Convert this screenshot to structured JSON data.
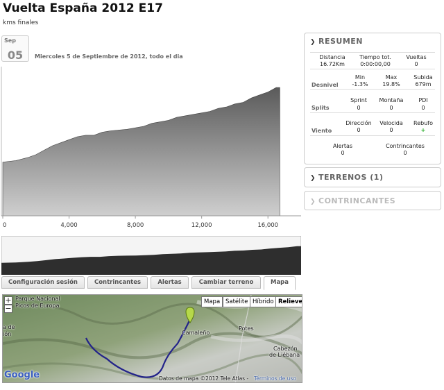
{
  "header": {
    "title": "Vuelta España 2012 E17",
    "subtitle": "kms finales"
  },
  "date": {
    "month": "Sep",
    "day": "05",
    "text": "Miercoles 5 de Septiembre de 2012, todo el dia"
  },
  "chart_data": {
    "type": "area",
    "x_unit": "m",
    "x_ticks": [
      "0",
      "4,000",
      "8,000",
      "12,000",
      "16,000"
    ],
    "xlim": [
      0,
      18000
    ],
    "x": [
      0,
      800,
      1500,
      2000,
      2500,
      3000,
      3500,
      4000,
      4500,
      5000,
      5500,
      6000,
      6500,
      7000,
      7500,
      8000,
      8500,
      9000,
      9500,
      10000,
      10500,
      11000,
      11500,
      12000,
      12500,
      13000,
      13500,
      14000,
      14500,
      15000,
      15500,
      16000,
      16500,
      16720
    ],
    "y": [
      0.36,
      0.37,
      0.39,
      0.41,
      0.44,
      0.47,
      0.49,
      0.51,
      0.53,
      0.54,
      0.54,
      0.56,
      0.57,
      0.575,
      0.58,
      0.59,
      0.6,
      0.62,
      0.63,
      0.64,
      0.66,
      0.67,
      0.68,
      0.69,
      0.7,
      0.72,
      0.73,
      0.75,
      0.76,
      0.79,
      0.81,
      0.83,
      0.86,
      0.86
    ],
    "y_note": "relative elevation (no y-axis printed)",
    "color": "#666666"
  },
  "tabs": [
    {
      "label": "Configuración sesión"
    },
    {
      "label": "Contrincantes"
    },
    {
      "label": "Alertas"
    },
    {
      "label": "Cambiar terreno"
    },
    {
      "label": "Mapa",
      "active": true
    }
  ],
  "map": {
    "buttons": [
      "Mapa",
      "Satélite",
      "Híbrido",
      "Relieve"
    ],
    "selected": "Relieve",
    "labels": {
      "park1": "Parque Nacional",
      "park2": "Picos de Europa",
      "camaleno": "Camaleño",
      "potes": "Potes",
      "cabezon1": "Cabezón",
      "cabezon2": "de Liébana",
      "left_edge1": "a de",
      "left_edge2": "ión",
      "credit": "Datos de mapa ©2012 Tele Atlas -",
      "terms": "Términos de uso",
      "google": "Google"
    }
  },
  "resumen": {
    "title": "RESUMEN",
    "row1": {
      "headers": [
        "Distancia",
        "Tiempo tot.",
        "Vueltas"
      ],
      "values": [
        "16.72Km",
        "0:00:00,00",
        "0"
      ]
    },
    "row2": {
      "label": "Desnivel",
      "headers": [
        "Min",
        "Max",
        "Subida"
      ],
      "values": [
        "-1.3%",
        "19.8%",
        "679m"
      ]
    },
    "row3": {
      "label": "Splits",
      "headers": [
        "Sprint",
        "Montaña",
        "PDI"
      ],
      "values": [
        "0",
        "0",
        "0"
      ]
    },
    "row4": {
      "label": "Viento",
      "headers": [
        "Dirección",
        "Velocida",
        "Rebufo"
      ],
      "values": [
        "0",
        "0",
        "+"
      ]
    },
    "row5": {
      "headers": [
        "Alertas",
        "Contrincantes"
      ],
      "values": [
        "0",
        "0"
      ]
    }
  },
  "panels": {
    "terrenos": "TERRENOS (1)",
    "contrincantes": "CONTRINCANTES"
  }
}
